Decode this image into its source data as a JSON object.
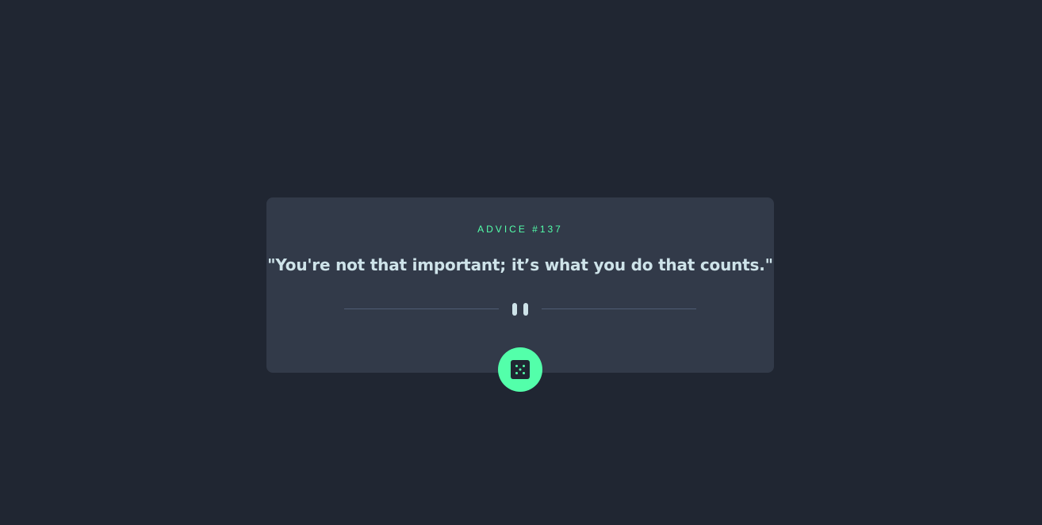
{
  "advice": {
    "label": "ADVICE #137",
    "quote": "\"You're not that important; it’s what you do that counts.\""
  },
  "icons": {
    "divider": "pause-icon",
    "button": "dice-icon"
  },
  "colors": {
    "background": "#202632",
    "card": "#323a49",
    "accent": "#53ffaa",
    "text": "#cee3e9",
    "divider": "#4f5d74"
  }
}
